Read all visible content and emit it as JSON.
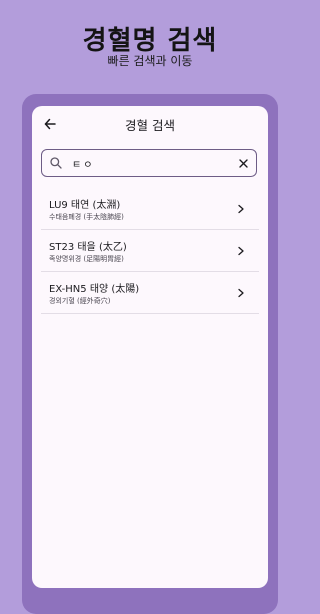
{
  "header": {
    "title": "경혈명 검색",
    "subtitle": "빠른 검색과 이동"
  },
  "app_bar": {
    "back_icon": "arrow-left-icon",
    "title": "경혈 검색"
  },
  "search": {
    "icon": "search-icon",
    "value": "ㅌㅇ",
    "clear_icon": "close-icon"
  },
  "results": [
    {
      "title": "LU9 태연 (太淵)",
      "subtitle": "수태음폐경 (手太陰肺經)"
    },
    {
      "title": "ST23 태을 (太乙)",
      "subtitle": "족양명위경 (足陽明胃經)"
    },
    {
      "title": "EX-HN5 태양 (太陽)",
      "subtitle": "경외기혈 (經外奇穴)"
    }
  ],
  "colors": {
    "background": "#b39ddb",
    "frame": "#8e72bd",
    "screen": "#fdf8fd",
    "search_border": "#6d5c86"
  }
}
